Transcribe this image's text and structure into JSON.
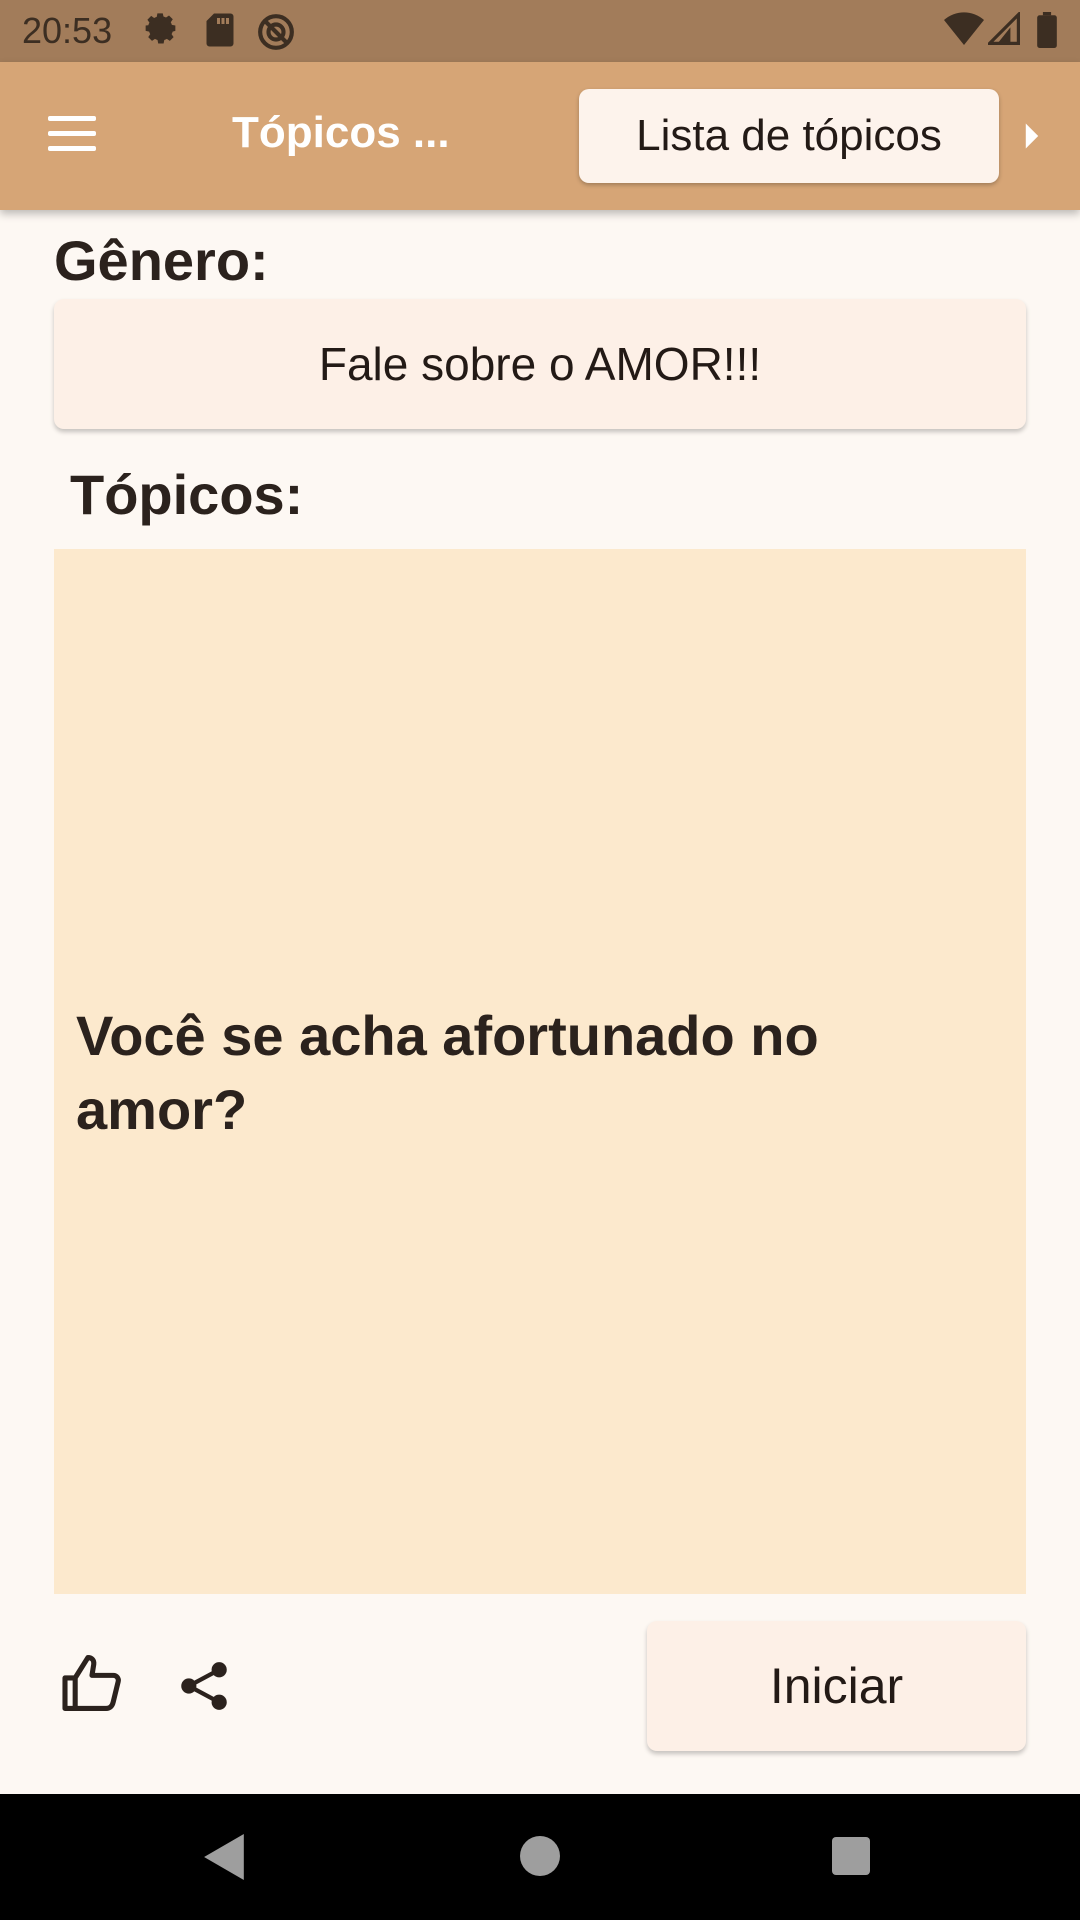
{
  "status_bar": {
    "time": "20:53",
    "icons": [
      "settings-icon",
      "sd-card-icon",
      "no-disturb-icon",
      "wifi-icon",
      "signal-icon",
      "battery-icon"
    ]
  },
  "app_bar": {
    "title": "Tópicos ...",
    "list_button_label": "Lista de tópicos",
    "icons": [
      "menu-icon",
      "arrow-right-icon"
    ]
  },
  "genre": {
    "label": "Gênero:",
    "value": "Fale sobre o AMOR!!!"
  },
  "topics": {
    "label": "Tópicos:",
    "current_topic": "Você se acha afortunado no amor?"
  },
  "actions": {
    "start_label": "Iniciar",
    "icons": [
      "thumbs-up-icon",
      "share-icon"
    ]
  },
  "nav_bar": {
    "icons": [
      "back-icon",
      "home-icon",
      "recents-icon"
    ]
  },
  "colors": {
    "status_bar": "#a27c5a",
    "app_bar": "#d6a576",
    "background": "#fdf8f3",
    "card": "#fce9cd",
    "button": "#fdf0e7"
  }
}
